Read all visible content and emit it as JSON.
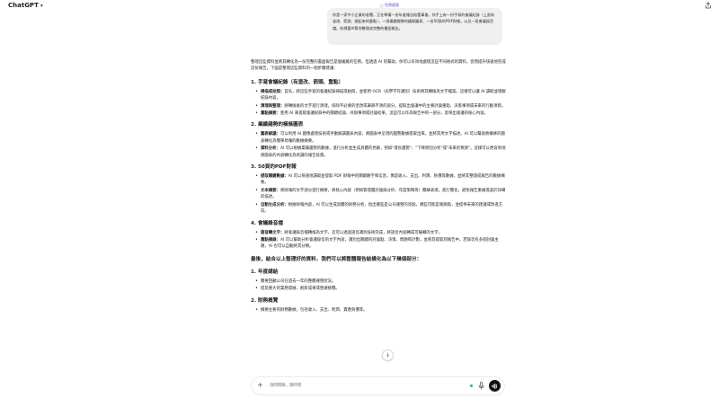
{
  "header": {
    "app_title": "ChatGPT"
  },
  "badge": {
    "label": "免費優惠"
  },
  "user_message": "你是一家中小企業的老闆，正在準備一份年度報告給董事會。你手上有一份手寫的會議紀錄（上面有塗改、箭頭、圈起來的重點），一張業績趨勢的橫條圖表、一份50頁的PDF財報，以及一段會議錄音檔。你想要AI幫你整理成完整的書面報告。",
  "reply": {
    "intro": "整理這些資料並將其轉化為一份完整的書面報告是個複雜的任務，但透過 AI 的幫助，你可以有效地處理這些不同格式的資料。從而提升快速地完成這份報告。下面是整理這些資料的一個步驟建議：",
    "sections": [
      {
        "title": "1. 手寫會議紀錄（有塗改、箭頭、重點）",
        "items": [
          {
            "term": "掃描或拍照：",
            "text": "首先，將這些手寫的會議紀錄掃描或拍照，並使用 OCR（光學字符識別）技術將其轉換為文字檔案。這樣可以讓 AI 讀取並理解紀錄內容。"
          },
          {
            "term": "清理與整理：",
            "text": "將轉換後的文字進行清理，排除不必要的塗改或筆跡不清的部分，提取出會議中的主要討論重點、決策事項或未來的行動項目。"
          },
          {
            "term": "重點摘要：",
            "text": "使用 AI 來提取會議紀錄中的關鍵結論、待辦事項或討論結果，這些可以作為報告中的一部分，反映出會議的核心內容。"
          }
        ]
      },
      {
        "title": "2. 業績趨勢的橫條圖表",
        "items": [
          {
            "term": "圖表解讀：",
            "text": "可以利用 AI 圖像處理技術或手動解讀圖表內容，將圖表中呈現的趨勢數據提取出來，並將其用文字描述。AI 可以幫助將橫條的圖表轉化為簡單易懂的數據摘要。"
          },
          {
            "term": "資料分析：",
            "text": "AI 可以根據業績趨勢的數據，進行分析並生成具體的見解，例如\"增長趨勢\"、\"下降原因分析\"或\"未來的預測\"。這樣可以更容易地將圖表的內容轉化為易讀的報告段落。"
          }
        ]
      },
      {
        "title": "3. 50頁的PDF財報",
        "items": [
          {
            "term": "提取關鍵數據：",
            "text": "AI 可以快速地讀取並提取 PDF 財報中的關鍵數字和信息，像是收入、支出、利潤、負債等數據，並將其整理成報告的數據摘要。"
          },
          {
            "term": "文本摘要：",
            "text": "將財報的文字部分進行摘要，將核心內容（例如管理層討論與分析、年度策略等）簡練表達，進行簡化，避免報告重複或過於詳細的描述。"
          },
          {
            "term": "自動生成分析：",
            "text": "根據財報內容，AI 可以生成具體的財務分析，指出哪些是公司運營的亮點，哪些可能是風險點，並提供未來的建議或改進方向。"
          }
        ]
      },
      {
        "title": "4. 會議錄音檔",
        "items": [
          {
            "term": "語音轉文字：",
            "text": "將會議錄音檔轉換為文字。這可以透過語音識別技術完成，將語音內容轉成可編輯的文字。"
          },
          {
            "term": "重點摘錄：",
            "text": "AI 可以幫助分析會議錄音的文字內容，識別出關鍵的討論點、決策、問題和計劃，並將其提取到報告中。若錄音有多個討論主題，AI 也可以自動將其分類。"
          }
        ]
      }
    ],
    "summary_heading": "最後，結合以上整理好的資料，我們可以將整體報告結構化為以下幾個部分：",
    "outline": [
      {
        "title": "1. 年度總結",
        "items": [
          "簡要回顧公司在過去一年的整體運營狀況。",
          "提及重大的業務發展、創新成果或營運挑戰。"
        ]
      },
      {
        "title": "2. 財務概覽",
        "items": [
          "摘要主要的財務數據，包括收入、支出、利潤、資產負債等。"
        ]
      }
    ]
  },
  "composer": {
    "placeholder": "詢問問題，隨時問"
  },
  "icons": {
    "share": "share-icon",
    "scroll": "arrow-down-icon",
    "plus": "plus-icon",
    "mic": "microphone-icon",
    "voice": "voice-mode-icon",
    "chevron": "chevron-down-icon",
    "badge": "sparkle-icon"
  },
  "colors": {
    "accent": "#6b5bd0",
    "status": "#2bb673",
    "voice_button": "#111111",
    "user_bubble": "#f0f0f0"
  }
}
